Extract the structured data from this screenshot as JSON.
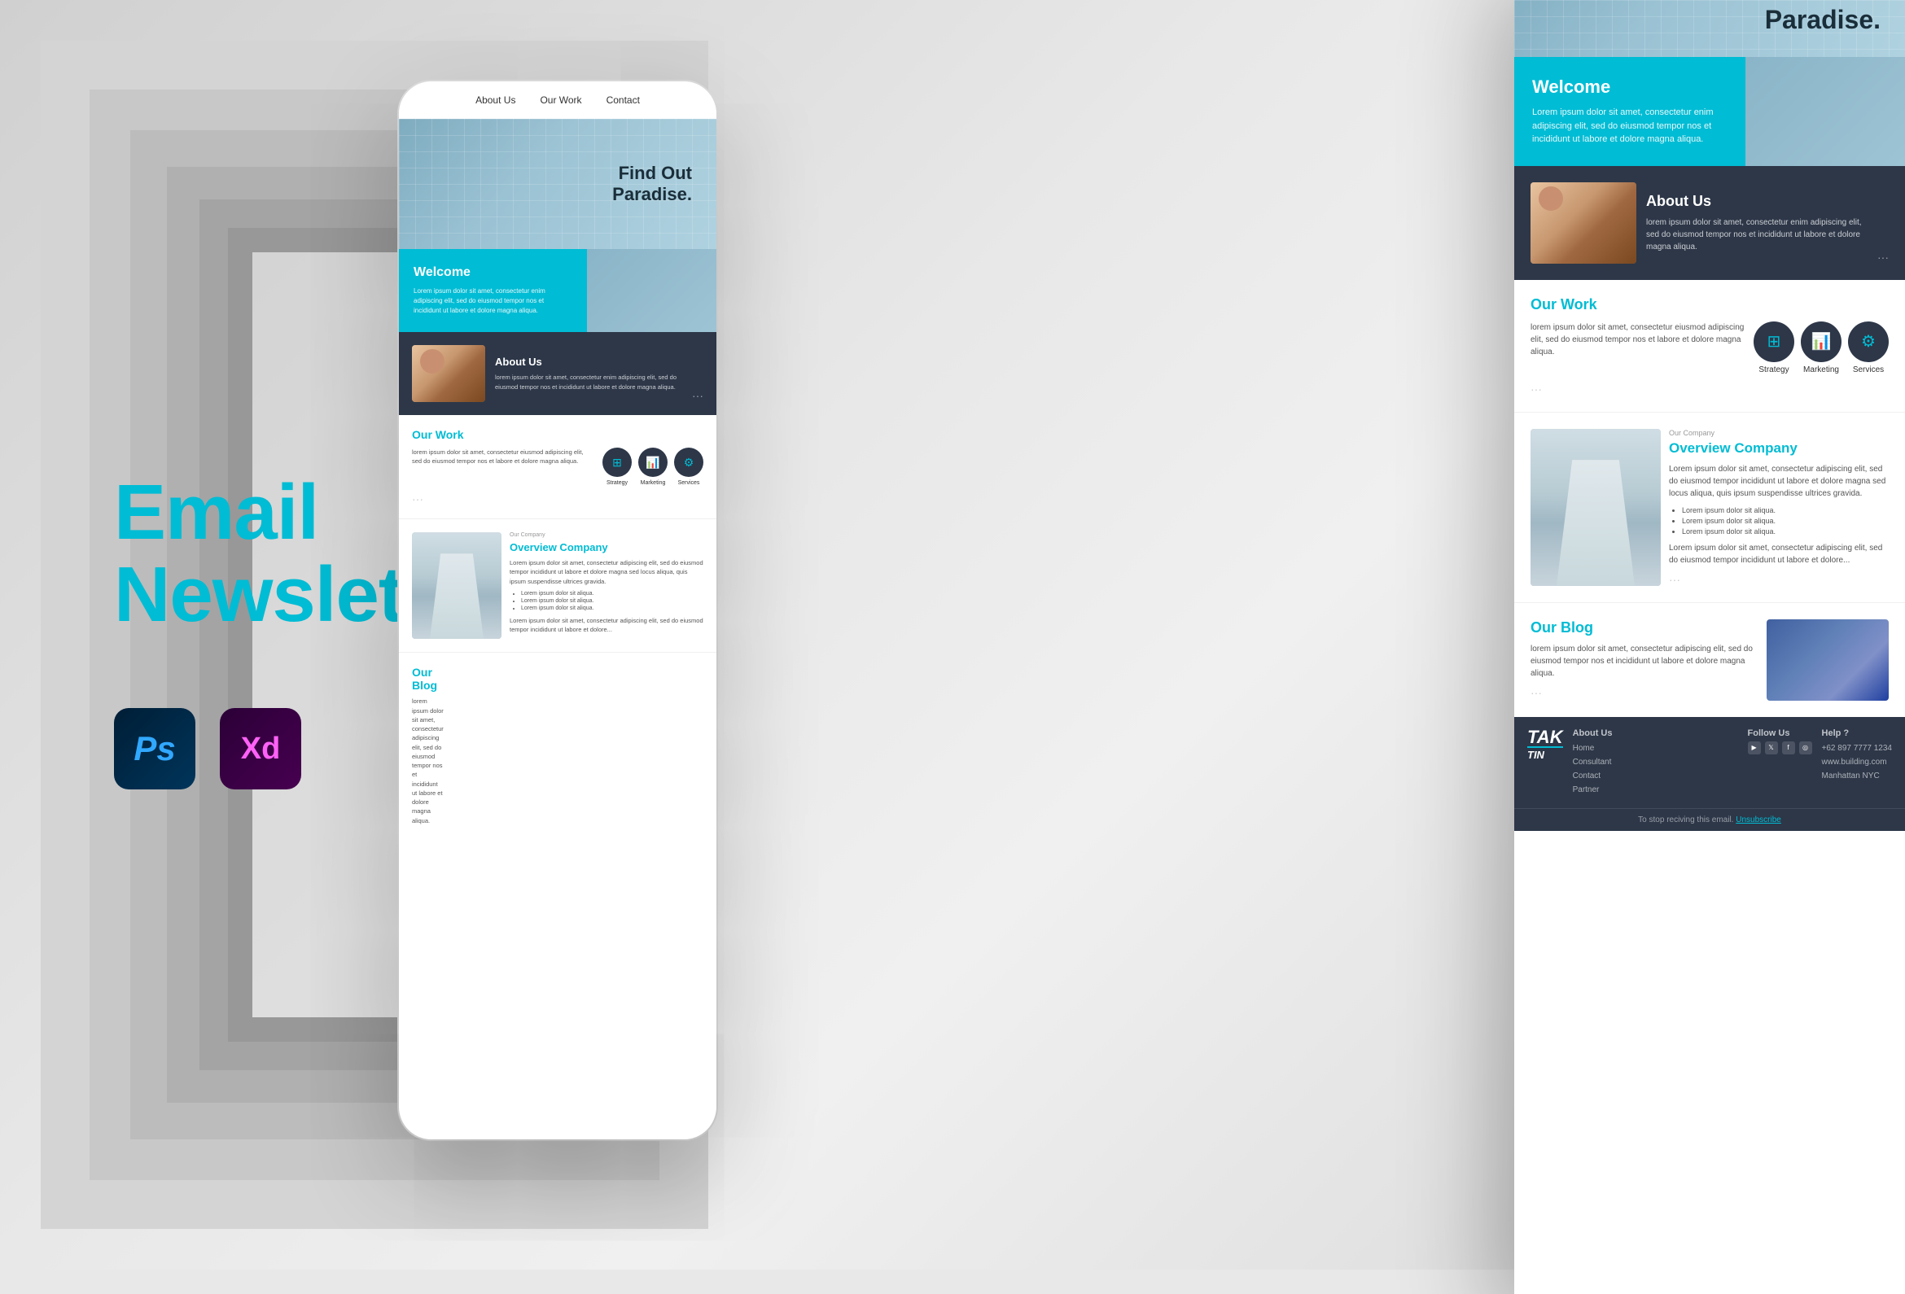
{
  "page": {
    "title": "Email Newsletter",
    "subtitle": "Email\nNewsletter"
  },
  "software": {
    "ps_label": "Ps",
    "xd_label": "Xd"
  },
  "nav": {
    "items": [
      "About Us",
      "Our Work",
      "Contact"
    ]
  },
  "hero": {
    "heading_line1": "Find Out",
    "heading_line2": "Paradise."
  },
  "welcome": {
    "heading": "Welcome",
    "body": "Lorem ipsum dolor sit amet, consectetur enim adipiscing elit, sed do eiusmod tempor nos et incididunt ut labore et dolore magna aliqua."
  },
  "about": {
    "heading": "About Us",
    "body": "lorem ipsum dolor sit amet, consectetur enim adipiscing elit, sed do eiusmod tempor nos et incididunt ut labore et dolore magna aliqua."
  },
  "ourwork": {
    "heading": "Our Work",
    "body": "lorem ipsum dolor sit amet, consectetur eiusmod adipiscing elit, sed do eiusmod tempor nos et labore et dolore magna aliqua.",
    "icons": [
      {
        "label": "Strategy",
        "symbol": "⊞"
      },
      {
        "label": "Marketing",
        "symbol": "📊"
      },
      {
        "label": "Services",
        "symbol": "⚙"
      }
    ]
  },
  "overview": {
    "company_label": "Our Company",
    "heading": "Overview Company",
    "body": "Lorem ipsum dolor sit amet, consectetur adipiscing elit, sed do eiusmod tempor incididunt ut labore et dolore magna sed locus aliqua, quis ipsum suspendisse ultrices gravida.",
    "list": [
      "Lorem ipsum dolor sit aliqua.",
      "Lorem ipsum dolor sit aliqua.",
      "Lorem ipsum dolor sit aliqua."
    ],
    "footer_text": "Lorem ipsum dolor sit amet, consectetur adipiscing elit, sed do eiusmod tempor incididunt ut labore et dolore..."
  },
  "blog": {
    "heading": "Our Blog",
    "body": "lorem ipsum dolor sit amet, consectetur adipiscing elit, sed do eiusmod tempor nos et incididunt ut labore et dolore magna aliqua."
  },
  "footer": {
    "logo_line1": "TAK",
    "logo_line2": "TIN",
    "about_links": [
      "About Us",
      "Home",
      "Consultant",
      "Contact",
      "Partner"
    ],
    "follow_heading": "Follow Us",
    "help_heading": "Help ?",
    "phone": "+62 897 7777 1234",
    "website": "www.building.com",
    "city": "Manhattan NYC",
    "unsub_text": "To stop reciving this email.",
    "unsub_link": "Unsubscribe"
  },
  "colors": {
    "accent": "#00bcd4",
    "dark": "#2d3748",
    "text": "#555555",
    "light_text": "#999999"
  }
}
